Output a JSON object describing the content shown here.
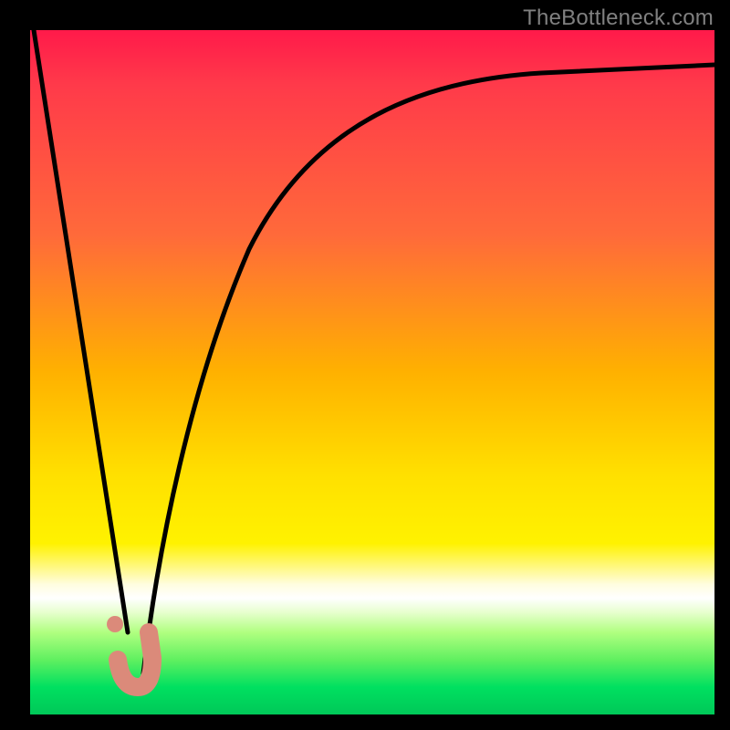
{
  "watermark": "TheBottleneck.com",
  "colors": {
    "curve_stroke": "#000000",
    "marker_fill": "#db8a7a",
    "marker_stroke": "#db8a7a"
  },
  "chart_data": {
    "type": "line",
    "title": "",
    "xlabel": "",
    "ylabel": "",
    "xlim": [
      0,
      100
    ],
    "ylim": [
      0,
      100
    ],
    "series": [
      {
        "name": "left-branch",
        "x": [
          0.5,
          3,
          6,
          9,
          12,
          14.2
        ],
        "y": [
          100,
          82,
          64,
          46,
          28,
          12
        ]
      },
      {
        "name": "right-branch",
        "x": [
          16.5,
          18,
          20,
          23,
          27,
          32,
          40,
          50,
          62,
          78,
          95,
          100
        ],
        "y": [
          6,
          17,
          30,
          45,
          58,
          68,
          78,
          84.5,
          89,
          92.5,
          94.7,
          95
        ]
      }
    ],
    "annotations": {
      "valley_floor_x_range": [
        12.8,
        17.2
      ],
      "valley_floor_y": 4.5,
      "marker_point": {
        "x": 12.4,
        "y": 13.2
      }
    }
  }
}
